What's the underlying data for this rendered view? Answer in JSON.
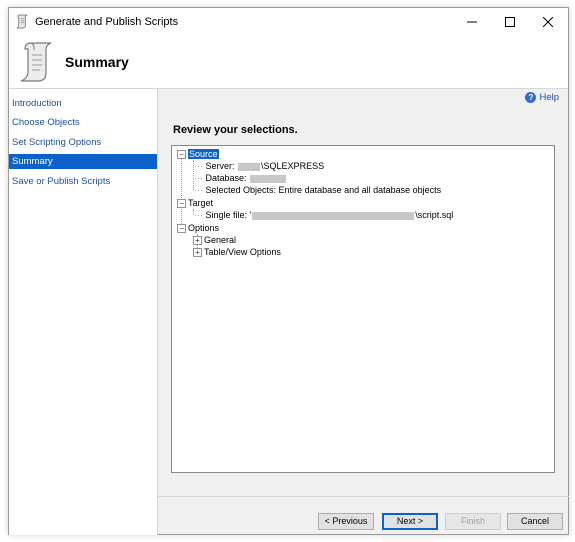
{
  "window": {
    "title": "Generate and Publish Scripts",
    "icon": "scroll-icon"
  },
  "header": {
    "title": "Summary",
    "icon": "scroll-icon"
  },
  "sidebar": {
    "items": [
      {
        "label": "Introduction",
        "selected": false
      },
      {
        "label": "Choose Objects",
        "selected": false
      },
      {
        "label": "Set Scripting Options",
        "selected": false
      },
      {
        "label": "Summary",
        "selected": true
      },
      {
        "label": "Save or Publish Scripts",
        "selected": false
      }
    ]
  },
  "content": {
    "help_label": "Help",
    "review_label": "Review your selections.",
    "tree": {
      "source": {
        "label": "Source",
        "server_prefix": "Server:",
        "server_suffix": "\\SQLEXPRESS",
        "database_prefix": "Database:",
        "database_suffix": "",
        "selected_objects": "Selected Objects: Entire database and all database objects"
      },
      "target": {
        "label": "Target",
        "file_prefix": "Single file: '",
        "file_suffix": "\\script.sql"
      },
      "options": {
        "label": "Options",
        "children": [
          "General",
          "Table/View Options"
        ]
      }
    }
  },
  "footer": {
    "previous": "< Previous",
    "next": "Next >",
    "finish": "Finish",
    "cancel": "Cancel"
  },
  "colors": {
    "accent": "#0d62c9",
    "link": "#1e4fa8"
  }
}
